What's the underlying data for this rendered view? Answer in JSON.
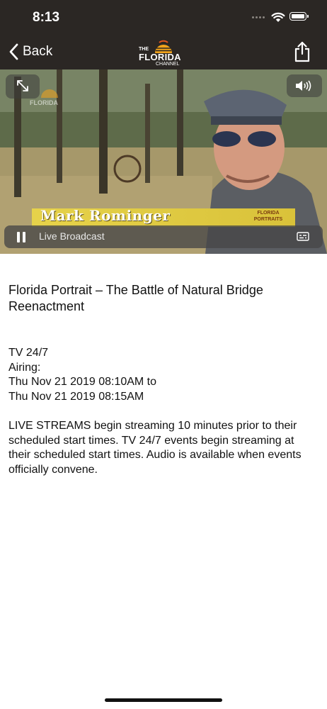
{
  "status_bar": {
    "time": "8:13"
  },
  "nav": {
    "back_label": "Back",
    "logo": {
      "the": "THE",
      "florida": "FLORIDA",
      "channel": "CHANNEL"
    }
  },
  "player": {
    "lower_third_name": "Mark Rominger",
    "lower_third_badge": "FLORIDA PORTRAITS",
    "live_label": "Live Broadcast",
    "watermark": "FLORIDA"
  },
  "event": {
    "title": "Florida Portrait – The Battle of Natural Bridge Reenactment",
    "channel": "TV 24/7",
    "airing_label": "Airing:",
    "start": "Thu Nov 21 2019 08:10AM to",
    "end": "Thu Nov 21 2019 08:15AM",
    "notice": "LIVE STREAMS begin streaming 10 minutes prior to their scheduled start times. TV 24/7 events begin streaming at their scheduled start times. Audio is available when events officially convene."
  },
  "colors": {
    "nav_background": "#2b2724",
    "logo_sun": "#f2a31b",
    "lower_third": "#e6d24a"
  }
}
